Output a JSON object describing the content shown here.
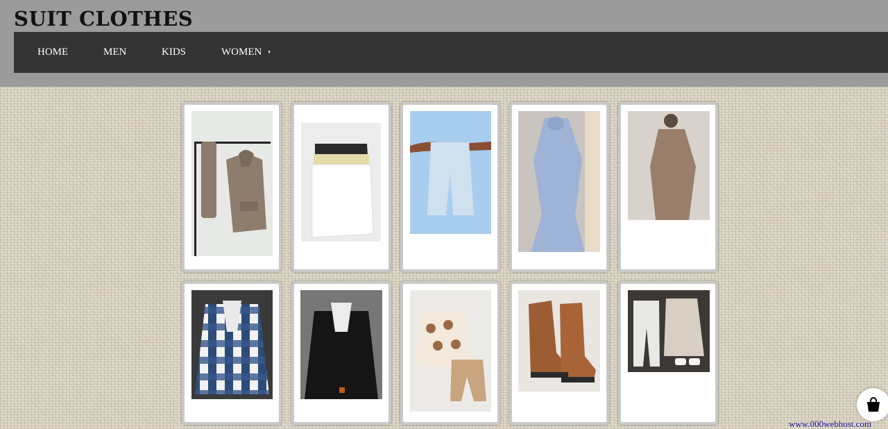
{
  "site": {
    "title": "SUIT CLOTHES"
  },
  "nav": {
    "items": [
      {
        "label": "HOME"
      },
      {
        "label": "MEN"
      },
      {
        "label": "KIDS"
      },
      {
        "label": "WOMEN",
        "has_dropdown": true,
        "arrow": "▾"
      }
    ]
  },
  "products": [
    {
      "row": 1,
      "image": "hoodie-set-on-hanger"
    },
    {
      "row": 1,
      "image": "folded-tshirts"
    },
    {
      "row": 1,
      "image": "light-wash-jeans"
    },
    {
      "row": 1,
      "image": "light-blue-dress"
    },
    {
      "row": 1,
      "image": "beige-dress"
    },
    {
      "row": 2,
      "image": "plaid-flannel-jacket"
    },
    {
      "row": 2,
      "image": "black-denim-jacket"
    },
    {
      "row": 2,
      "image": "kids-hedgehog-set"
    },
    {
      "row": 2,
      "image": "brown-lace-up-boots"
    },
    {
      "row": 2,
      "image": "sweatpants-and-plaid-hoodie"
    }
  ],
  "footer": {
    "watermark": "www.000webhost.com"
  },
  "cart": {
    "icon": "shopping-bag-icon"
  },
  "colors": {
    "header_bg": "#9b9b9b",
    "nav_bg": "#333333",
    "card_border": "#c9c9c9"
  }
}
